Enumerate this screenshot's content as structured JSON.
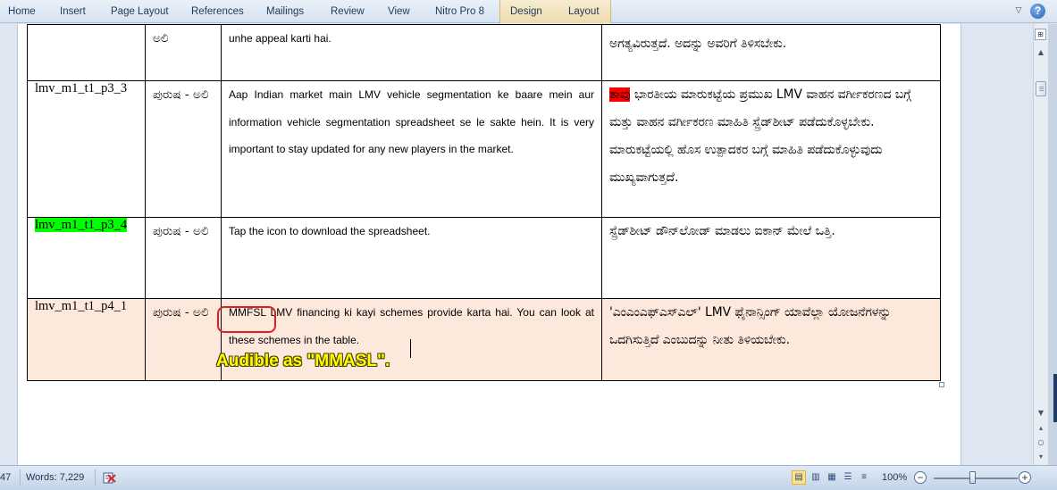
{
  "ribbon": {
    "tabs": [
      "Home",
      "Insert",
      "Page Layout",
      "References",
      "Mailings",
      "Review",
      "View",
      "Nitro Pro 8",
      "Design",
      "Layout"
    ],
    "help": "?"
  },
  "table": {
    "rows": [
      {
        "id": "",
        "speaker": "ಅಲಿ",
        "english": "unhe appeal karti hai.",
        "kannada": "ಅಗತ್ಯವಿರುತ್ತದೆ. ಅದನ್ನು ಅವರಿಗೆ ತಿಳಿಸಬೇಕು."
      },
      {
        "id": "lmv_m1_t1_p3_3",
        "speaker": "ಪುರುಷ - ಅಲಿ",
        "english": "Aap Indian market main LMV vehicle segmentation ke baare mein aur information vehicle segmentation spreadsheet se le sakte hein. It is very important to stay updated for any new players in the market.",
        "kannada_highlight": "ತಾವು",
        "kannada": " ಭಾರತೀಯ ಮಾರುಕಟ್ಟೆಯ ಪ್ರಮುಖ LMV ವಾಹನ ವರ್ಗೀಕರಣದ ಬಗ್ಗೆ ಮತ್ತು ವಾಹನ ವರ್ಗೀಕರಣ ಮಾಹಿತಿ ಸ್ಪ್ರೆಡ್‌ಶೀಟ್ ಪಡೆದುಕೊಳ್ಳಬೇಕು. ಮಾರುಕಟ್ಟೆಯಲ್ಲಿ ಹೊಸ ಉತ್ಪಾದಕರ ಬಗ್ಗೆ ಮಾಹಿತಿ ಪಡೆದುಕೊಳ್ಳುವುದು ಮುಖ್ಯವಾಗುತ್ತದೆ."
      },
      {
        "id": "lmv_m1_t1_p3_4",
        "speaker": "ಪುರುಷ - ಅಲಿ",
        "english": "Tap the icon to download the spreadsheet.",
        "kannada": "ಸ್ಪ್ರೆಡ್‌ಶೀಟ್ ಡೌನ್‌ಲೋಡ್ ಮಾಡಲು ಐಕಾನ್ ಮೇಲೆ ಒತ್ತಿ."
      },
      {
        "id": "lmv_m1_t1_p4_1",
        "speaker": "ಪುರುಷ - ಅಲಿ",
        "english": "MMFSL LMV financing ki kayi schemes provide karta hai. You can look at these schemes in the table.",
        "kannada": "'ಎಂಎಂಎಫ್ಎಸ್‌ಎಲ್' LMV ಫೈನಾನ್ಸಿಂಗ್ ಯಾವೆಲ್ಲಾ ಯೋಜನೆಗಳನ್ನು ಒದಗಿಸುತ್ತಿದೆ ಎಂಬುದನ್ನು ನೀತು ತಿಳಿಯಬೇಕು."
      }
    ]
  },
  "annotation": {
    "comment": "Audible as \"MMASL\"."
  },
  "status": {
    "page": "47",
    "words": "Words: 7,229",
    "zoom": "100%",
    "zoom_percent": 100
  },
  "colors": {
    "green_highlight": "#00ff00",
    "red_highlight": "#ff0000",
    "row_highlight": "#fce9dc",
    "annotation": "#ffff00",
    "circle": "#e02020"
  }
}
